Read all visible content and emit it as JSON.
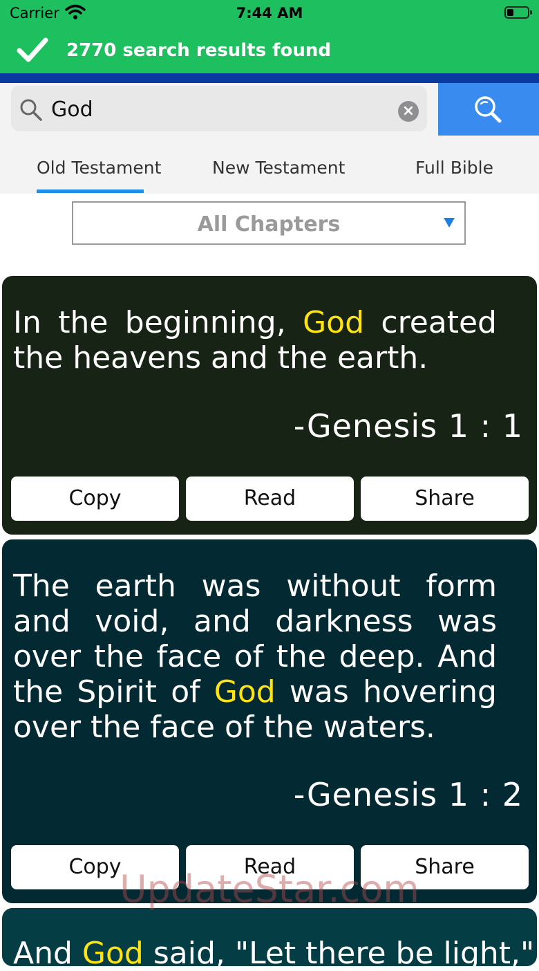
{
  "status_bar": {
    "carrier": "Carrier",
    "time": "7:44 AM"
  },
  "banner": {
    "message": "2770 search results found"
  },
  "search": {
    "query": "God",
    "clear_symbol": "×"
  },
  "tabs": [
    {
      "label": "Old Testament",
      "selected": true
    },
    {
      "label": "New Testament",
      "selected": false
    },
    {
      "label": "Full Bible",
      "selected": false
    }
  ],
  "chapter_filter": {
    "selected": "All Chapters"
  },
  "results": [
    {
      "text_before": "In the beginning, ",
      "highlight": "God",
      "text_after": " created the heavens and the earth.",
      "reference": "-Genesis 1 : 1",
      "buttons": {
        "copy": "Copy",
        "read": "Read",
        "share": "Share"
      }
    },
    {
      "text_before": "The earth was without form and void, and darkness was over the face of the deep. And the Spirit of ",
      "highlight": "God",
      "text_after": " was hovering over the face of the waters.",
      "reference": "-Genesis 1 : 2",
      "buttons": {
        "copy": "Copy",
        "read": "Read",
        "share": "Share"
      }
    },
    {
      "text_before": "And ",
      "highlight": "God",
      "text_after": " said, \"Let there be light,\""
    }
  ],
  "watermark": "UpdateStar.com",
  "colors": {
    "accent_green": "#1dbf5f",
    "search_blue": "#3a8bf0",
    "highlight_yellow": "#ffe313"
  }
}
